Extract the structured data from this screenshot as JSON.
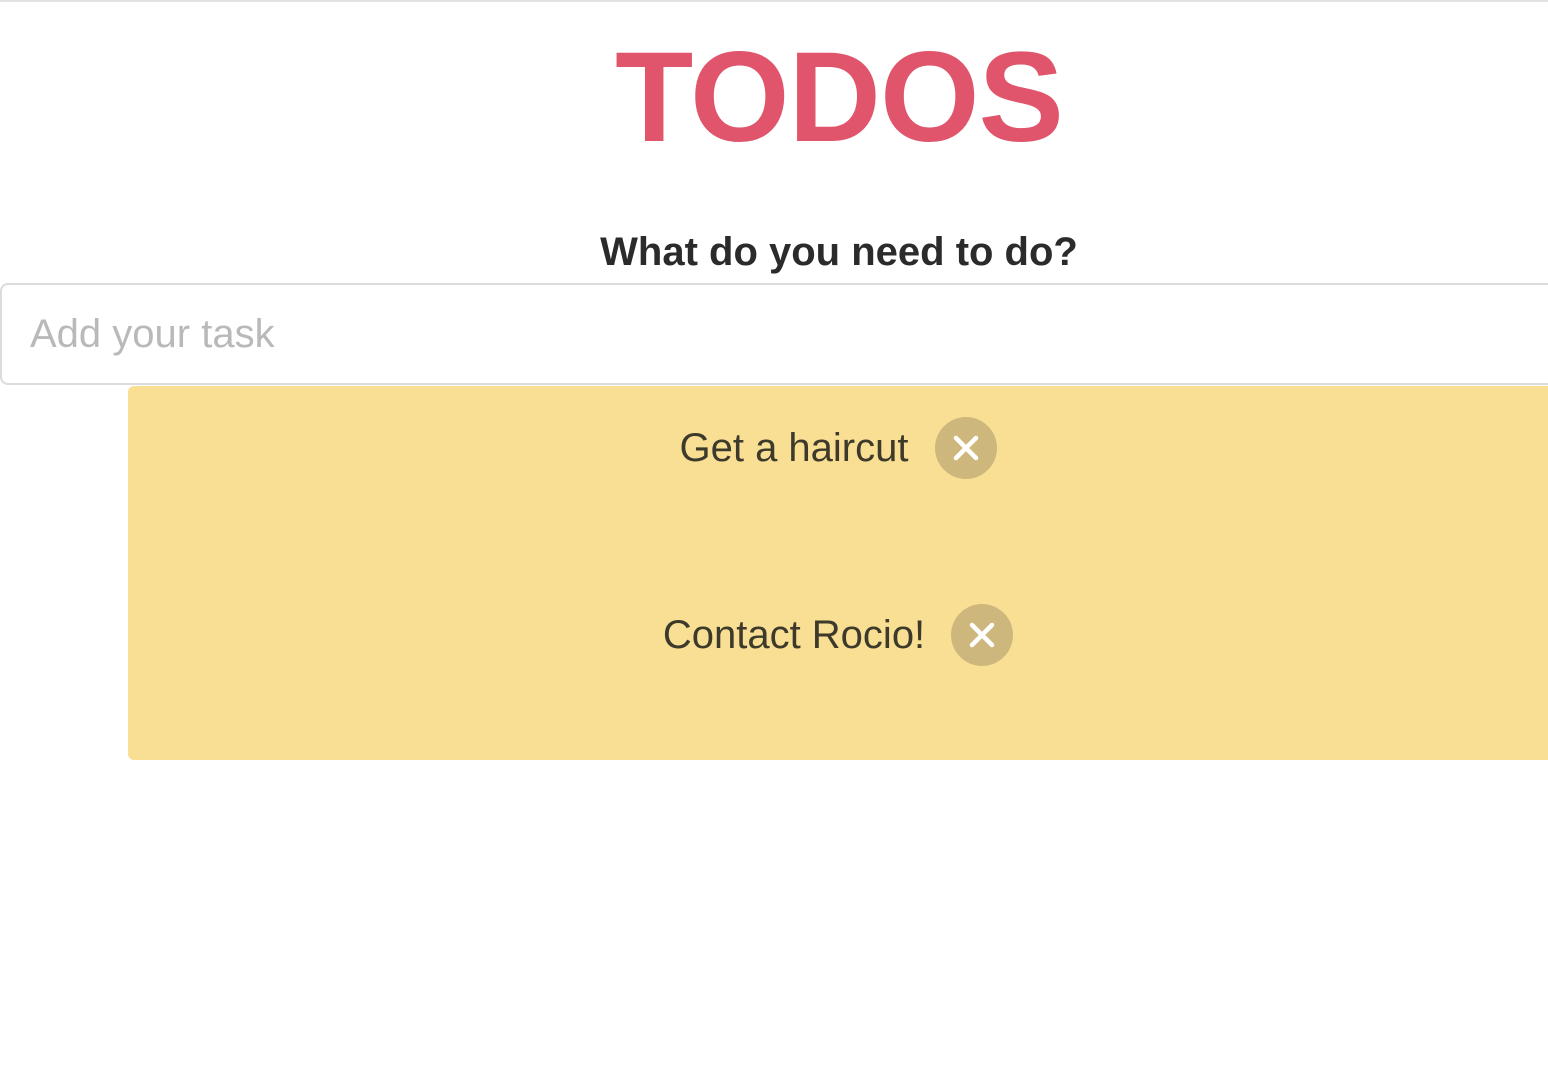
{
  "header": {
    "title": "TODOS",
    "title_color": "#e0546c"
  },
  "form": {
    "prompt": "What do you need to do?",
    "input_placeholder": "Add your task",
    "input_value": ""
  },
  "todos": {
    "panel_color": "#f9df94",
    "remove_button_color": "#cdb77c",
    "remove_icon": "close-icon",
    "items": [
      {
        "text": "Get a haircut"
      },
      {
        "text": "Contact Rocio!"
      }
    ]
  }
}
